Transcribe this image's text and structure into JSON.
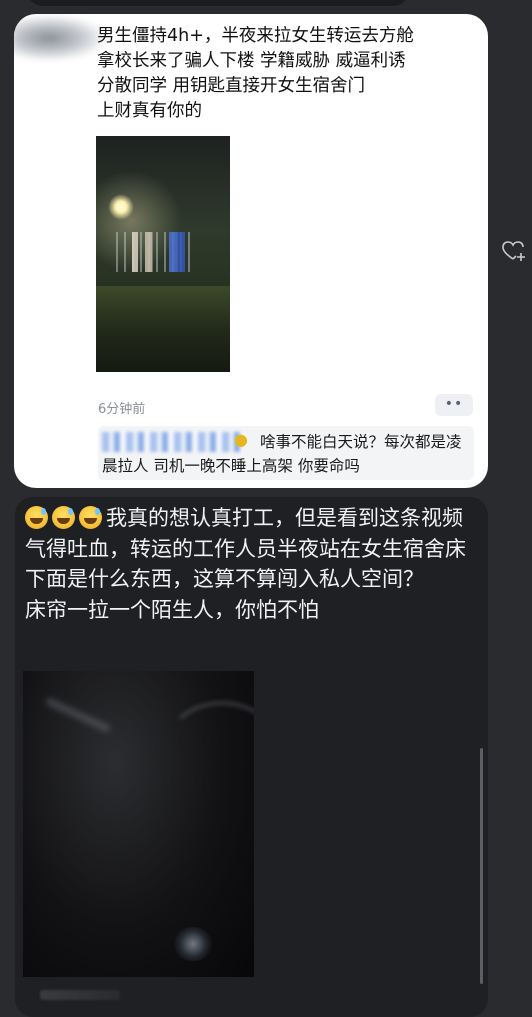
{
  "post1": {
    "text": "男生僵持4h+，半夜来拉女生转运去方舱\n拿校长来了骗人下楼 学籍威胁 威逼利诱\n分散同学   用钥匙直接开女生宿舍门\n上财真有你的",
    "timestamp": "6分钟前",
    "more_label": "••",
    "reply": {
      "emoji": "thinking-face-emoji",
      "text": "啥事不能白天说？每次都是凌晨拉人 司机一晚不睡上高架 你要命吗"
    }
  },
  "post2": {
    "emojis": [
      "sweat-smile-emoji",
      "sweat-smile-emoji",
      "sweat-smile-emoji"
    ],
    "text": "我真的想认真打工，但是看到这条视频气得吐血，转运的工作人员半夜站在女生宿舍床下面是什么东西，这算不算闯入私人空间？",
    "text_line2": "床帘一拉一个陌生人，你怕不怕"
  },
  "side_action": {
    "icon": "heart-plus-icon"
  },
  "colors": {
    "page_bg": "#2a2b2f",
    "card_light": "#ffffff",
    "card_dark": "#1f2023",
    "muted_text": "#8b8f96"
  }
}
